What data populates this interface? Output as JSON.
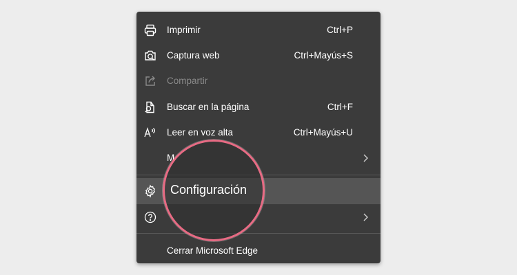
{
  "menu": {
    "print": {
      "label": "Imprimir",
      "shortcut": "Ctrl+P",
      "icon": "printer-icon"
    },
    "capture": {
      "label": "Captura web",
      "shortcut": "Ctrl+Mayús+S",
      "icon": "web-capture-icon"
    },
    "share": {
      "label": "Compartir",
      "icon": "share-icon",
      "disabled": true
    },
    "find": {
      "label": "Buscar en la página",
      "shortcut": "Ctrl+F",
      "icon": "find-on-page-icon"
    },
    "read_aloud": {
      "label": "Leer en voz alta",
      "shortcut": "Ctrl+Mayús+U",
      "icon": "read-aloud-icon"
    },
    "more_tools": {
      "label": "M",
      "icon": "chevron-right-icon"
    },
    "settings": {
      "label": "Configuración",
      "icon": "gear-icon"
    },
    "help": {
      "icon": "help-icon"
    },
    "close": {
      "label": "Cerrar Microsoft Edge"
    }
  },
  "colors": {
    "menu_bg": "#3b3b3b",
    "highlight_bg": "#555555",
    "accent_ring": "#e86b84",
    "page_bg": "#ededed"
  }
}
